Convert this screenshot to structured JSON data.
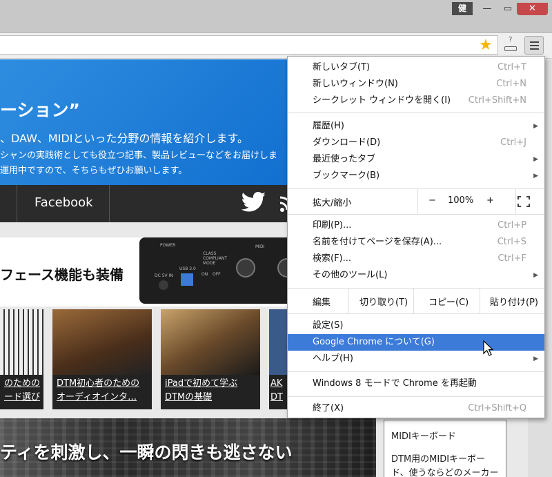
{
  "window": {
    "user_badge": "健",
    "minimize_glyph": "—",
    "maximize_glyph": "▭",
    "close_glyph": "✕"
  },
  "toolbar": {
    "bookmark_icon": "star-icon",
    "extension_icon": "extension-icon",
    "extension_glyph": "?",
    "menu_icon": "hamburger-menu-icon"
  },
  "page": {
    "hero": {
      "title": "ーション”",
      "line1": "、DAW、MIDIといった分野の情報を紹介します。",
      "line2": "シャンの実践術としても役立つ記事、製品レビューなどをお届けしま",
      "line3": "運用中ですので、そちらもぜひお願いします。"
    },
    "nav": {
      "facebook": "Facebook"
    },
    "banner_text": "フェース機能も装備",
    "device_labels": {
      "power": "POWER",
      "midi": "MIDI",
      "usb": "USB 3.0",
      "dc": "DC 5V IN",
      "class": "CLASS COMPLIANT MODE",
      "on": "ON",
      "off": "OFF"
    },
    "thumbs": [
      {
        "line1": "のための",
        "line2": "ード選び"
      },
      {
        "line1": "DTM初心者のための",
        "line2": "オーディオインタ…"
      },
      {
        "line1": "iPadで初めて学ぶ",
        "line2": "DTMの基礎"
      },
      {
        "line1": "AK",
        "line2": "DT"
      }
    ],
    "big_banner": "ティを刺激し、一瞬の閃きも逃さない",
    "sidebar": {
      "title": "MIDIキーボード",
      "text1": "DTM用のMIDIキーボー",
      "text2": "ド、使うならどのメーカー"
    }
  },
  "menu": {
    "group1": [
      {
        "label": "新しいタブ(T)",
        "shortcut": "Ctrl+T"
      },
      {
        "label": "新しいウィンドウ(N)",
        "shortcut": "Ctrl+N"
      },
      {
        "label": "シークレット ウィンドウを開く(I)",
        "shortcut": "Ctrl+Shift+N"
      }
    ],
    "group2": [
      {
        "label": "履歴(H)",
        "shortcut": ""
      },
      {
        "label": "ダウンロード(D)",
        "shortcut": "Ctrl+J"
      },
      {
        "label": "最近使ったタブ",
        "shortcut": ""
      },
      {
        "label": "ブックマーク(B)",
        "shortcut": ""
      }
    ],
    "zoom": {
      "label": "拡大/縮小",
      "minus": "−",
      "value": "100%",
      "plus": "+"
    },
    "group3": [
      {
        "label": "印刷(P)...",
        "shortcut": "Ctrl+P"
      },
      {
        "label": "名前を付けてページを保存(A)...",
        "shortcut": "Ctrl+S"
      },
      {
        "label": "検索(F)...",
        "shortcut": "Ctrl+F"
      },
      {
        "label": "その他のツール(L)",
        "shortcut": ""
      }
    ],
    "edit": {
      "label": "編集",
      "cut": "切り取り(T)",
      "copy": "コピー(C)",
      "paste": "貼り付け(P)"
    },
    "group4": [
      {
        "label": "設定(S)",
        "shortcut": ""
      },
      {
        "label": "Google Chrome について(G)",
        "shortcut": ""
      },
      {
        "label": "ヘルプ(H)",
        "shortcut": ""
      }
    ],
    "restart_windows8": "Windows 8 モードで Chrome を再起動",
    "exit": {
      "label": "終了(X)",
      "shortcut": "Ctrl+Shift+Q"
    },
    "submenu_arrow": "▶"
  },
  "colors": {
    "highlight": "#3d7bd9",
    "close_button": "#c7484b",
    "hero_blue": "#0a68cc",
    "star": "#f7b500"
  }
}
